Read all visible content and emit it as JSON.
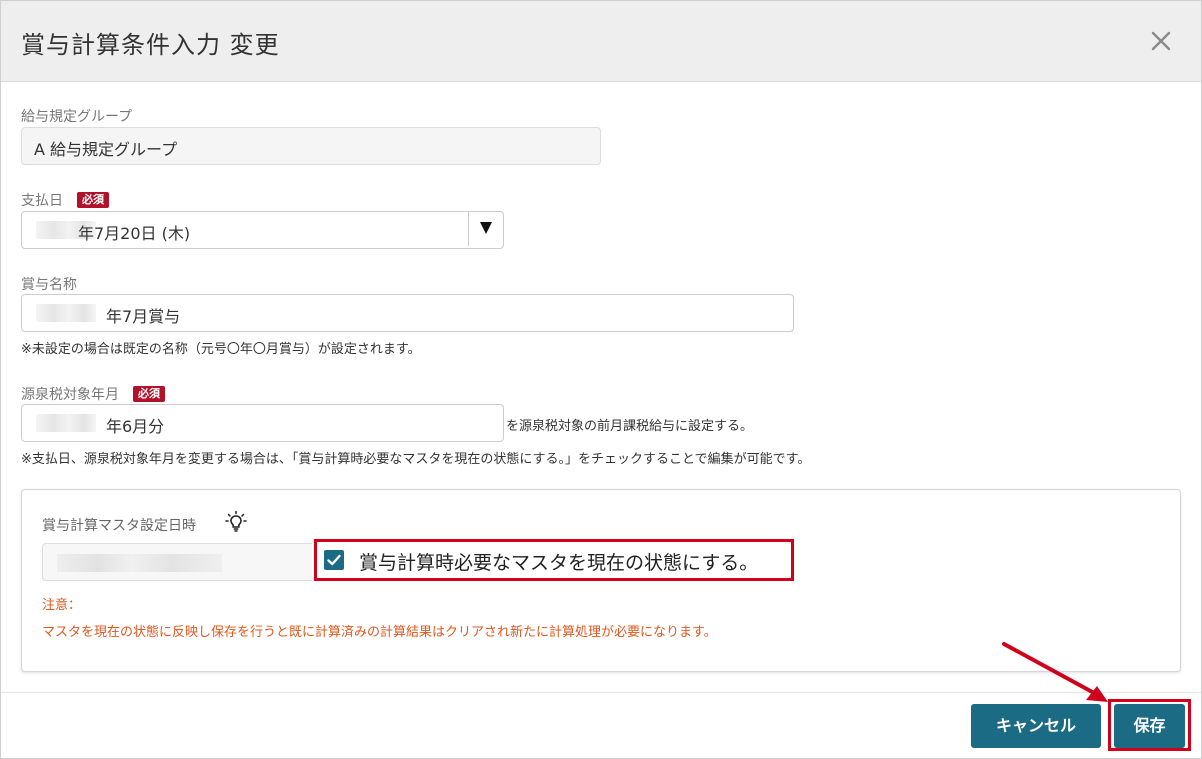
{
  "dialog": {
    "title": "賞与計算条件入力 変更",
    "close_icon": "close-icon"
  },
  "pay_group": {
    "label": "給与規定グループ",
    "value": "A 給与規定グループ"
  },
  "payment_date": {
    "label": "支払日",
    "required": "必須",
    "value": "年7月20日 (木)"
  },
  "bonus_name": {
    "label": "賞与名称",
    "value": "年7月賞与",
    "note": "※未設定の場合は既定の名称（元号〇年〇月賞与）が設定されます。"
  },
  "tax_month": {
    "label": "源泉税対象年月",
    "required": "必須",
    "value": "年6月分",
    "suffix": "を源泉税対象の前月課税給与に設定する。",
    "note": "※支払日、源泉税対象年月を変更する場合は、「賞与計算時必要なマスタを現在の状態にする。」をチェックすることで編集が可能です。"
  },
  "master_panel": {
    "label": "賞与計算マスタ設定日時",
    "hint_icon": "lightbulb-icon",
    "checkbox_label": "賞与計算時必要なマスタを現在の状態にする。",
    "checked": true,
    "warning_title": "注意：",
    "warning_text": "マスタを現在の状態に反映し保存を行うと既に計算済みの計算結果はクリアされ新たに計算処理が必要になります。"
  },
  "footer": {
    "cancel_label": "キャンセル",
    "save_label": "保存"
  },
  "colors": {
    "accent": "#1b6b84",
    "required_badge": "#b0112b",
    "warning": "#e0581f",
    "highlight": "#d0021b"
  }
}
